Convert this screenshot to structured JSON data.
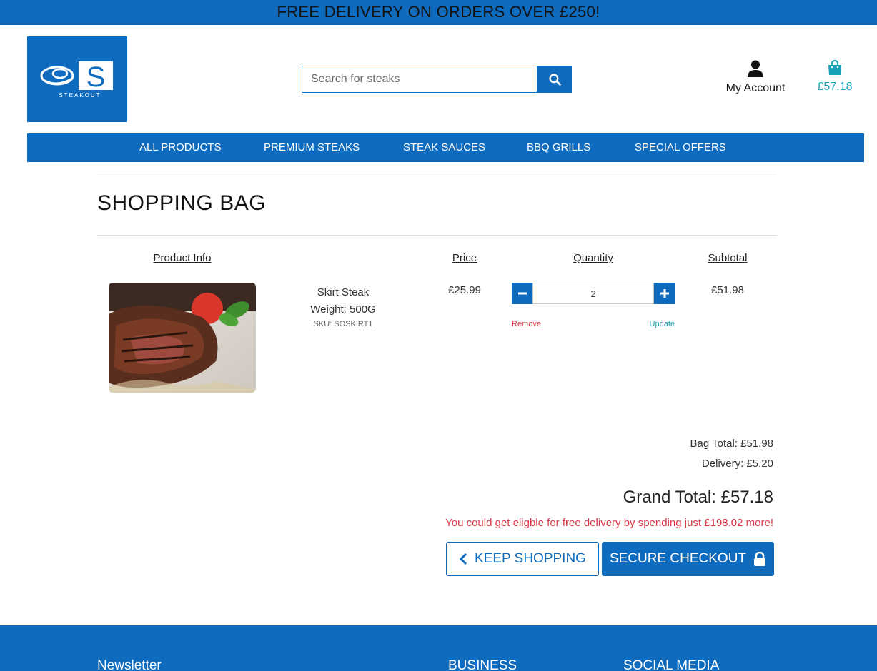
{
  "banner": {
    "text": "FREE DELIVERY ON ORDERS OVER £250!"
  },
  "logo": {
    "text": "STEAKOUT",
    "letter": "S"
  },
  "search": {
    "placeholder": "Search for steaks"
  },
  "header": {
    "account_label": "My Account",
    "bag_total": "£57.18"
  },
  "nav": {
    "items": [
      "ALL PRODUCTS",
      "PREMIUM STEAKS",
      "STEAK SAUCES",
      "BBQ GRILLS",
      "SPECIAL OFFERS"
    ]
  },
  "page": {
    "title": "SHOPPING BAG"
  },
  "table": {
    "headers": {
      "product_info": "Product Info",
      "price": "Price",
      "quantity": "Quantity",
      "subtotal": "Subtotal"
    }
  },
  "item": {
    "name": "Skirt Steak",
    "weight": "Weight: 500G",
    "sku": "SKU: SOSKIRT1",
    "price": "£25.99",
    "quantity": "2",
    "subtotal": "£51.98",
    "remove_label": "Remove",
    "update_label": "Update"
  },
  "summary": {
    "bag_total": "Bag Total: £51.98",
    "delivery": "Delivery: £5.20",
    "grand_total": "Grand Total: £57.18",
    "free_delivery_msg": "You could get eligble for free delivery by spending just £198.02 more!"
  },
  "actions": {
    "keep_shopping": "KEEP SHOPPING",
    "secure_checkout": "SECURE CHECKOUT"
  },
  "footer": {
    "headings": [
      "Newsletter",
      "BUSINESS",
      "SOCIAL MEDIA"
    ]
  },
  "colors": {
    "brand_blue": "#0f6bbd",
    "accent_teal": "#17a2b8",
    "alert_red": "#dc3545"
  },
  "icons": [
    "steak-logo-icon",
    "search-icon",
    "user-icon",
    "shopping-bag-icon",
    "minus-icon",
    "plus-icon",
    "chevron-left-icon",
    "lock-icon"
  ]
}
